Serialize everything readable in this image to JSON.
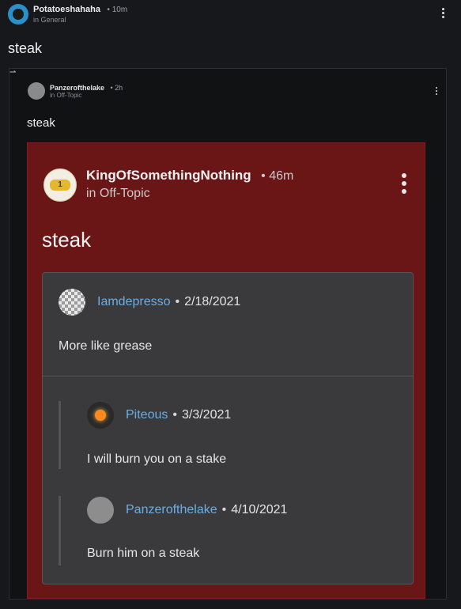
{
  "post": {
    "author": "Potatoeshahaha",
    "time": "• 10m",
    "category": "in General",
    "title": "steak"
  },
  "embed": {
    "notch": "⇀",
    "author": "Panzerofthelake",
    "time": "• 2h",
    "category": "in Off-Topic",
    "title": "steak",
    "card": {
      "author": "KingOfSomethingNothing",
      "time": "• 46m",
      "category": "in Off-Topic",
      "title": "steak",
      "avatar_badge": "1",
      "comments": [
        {
          "user": "Iamdepresso",
          "sep": "•",
          "date": "2/18/2021",
          "text": "More like grease"
        },
        {
          "user": "Piteous",
          "sep": "•",
          "date": "3/3/2021",
          "text": "I will burn you on a stake"
        },
        {
          "user": "Panzerofthelake",
          "sep": "•",
          "date": "4/10/2021",
          "text": "Burn him on a steak"
        }
      ]
    }
  },
  "colors": {
    "background": "#17181c",
    "card_red": "#6a1616",
    "comment_bg": "#3a3a3c",
    "username_blue": "#6aaee6"
  },
  "icons": {
    "menu": "kebab-menu-icon",
    "avatar": "avatar"
  }
}
